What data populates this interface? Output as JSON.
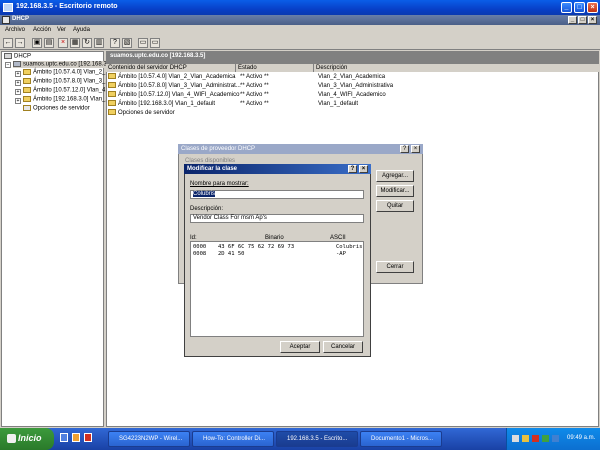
{
  "rd_window": {
    "title": "192.168.3.5 - Escritorio remoto"
  },
  "dhcp_window": {
    "title": "DHCP"
  },
  "menu": [
    "Archivo",
    "Acción",
    "Ver",
    "Ayuda"
  ],
  "tree": {
    "root": "DHCP",
    "server": "suamos.uptc.edu.co [192.168.3...",
    "scopes": [
      "Ámbito [10.57.4.0] Vlan_2_...",
      "Ámbito [10.57.8.0] Vlan_3_...",
      "Ámbito [10.57.12.0] Vlan_4...",
      "Ámbito [192.168.3.0] Vlan_1..."
    ],
    "options": "Opciones de servidor"
  },
  "right_header": "suamos.uptc.edu.co [192.168.3.5]",
  "columns": [
    "Contenido del servidor DHCP",
    "Estado",
    "Descripción"
  ],
  "rows": [
    {
      "name": "Ámbito [10.57.4.0] Vlan_2_Vlan_Academica",
      "status": "** Activo **",
      "desc": "Vlan_2_Vlan_Academica"
    },
    {
      "name": "Ámbito [10.57.8.0] Vlan_3_Vlan_Administrat...",
      "status": "** Activo **",
      "desc": "Vlan_3_Vlan_Administrativa"
    },
    {
      "name": "Ámbito [10.57.12.0] Vlan_4_WIFI_Academico",
      "status": "** Activo **",
      "desc": "Vlan_4_WIFI_Academico"
    },
    {
      "name": "Ámbito [192.168.3.0] Vlan_1_default",
      "status": "** Activo **",
      "desc": "Vlan_1_default"
    },
    {
      "name": "Opciones de servidor",
      "status": "",
      "desc": ""
    }
  ],
  "clases_dialog": {
    "title": "Clases de proveedor DHCP",
    "label": "Clases disponibles",
    "buttons": {
      "add": "Agregar...",
      "modify": "Modificar...",
      "remove": "Quitar",
      "close": "Cerrar"
    }
  },
  "mod_dialog": {
    "title": "Modificar la clase",
    "name_label": "Nombre para mostrar:",
    "name_value": "Colubris",
    "desc_label": "Descripción:",
    "desc_value": "Vendor Class For msm Ap's",
    "hex_headers": {
      "id": "Id:",
      "binary": "Binario",
      "ascii": "ASCII"
    },
    "hex_rows": [
      {
        "offset": "0000",
        "bytes": "43 6F 6C 75 62 72 69 73",
        "ascii": "Colubris"
      },
      {
        "offset": "0008",
        "bytes": "2D 41 50",
        "ascii": "-AP"
      }
    ],
    "accept": "Aceptar",
    "cancel": "Cancelar"
  },
  "taskbar": {
    "start": "Inicio",
    "tasks": [
      "SG4223N2WP - Wirel...",
      "How-To: Controller Di...",
      "192.168.3.5 - Escrito...",
      "Documento1 - Micros..."
    ],
    "clock": "09:49 a.m."
  }
}
